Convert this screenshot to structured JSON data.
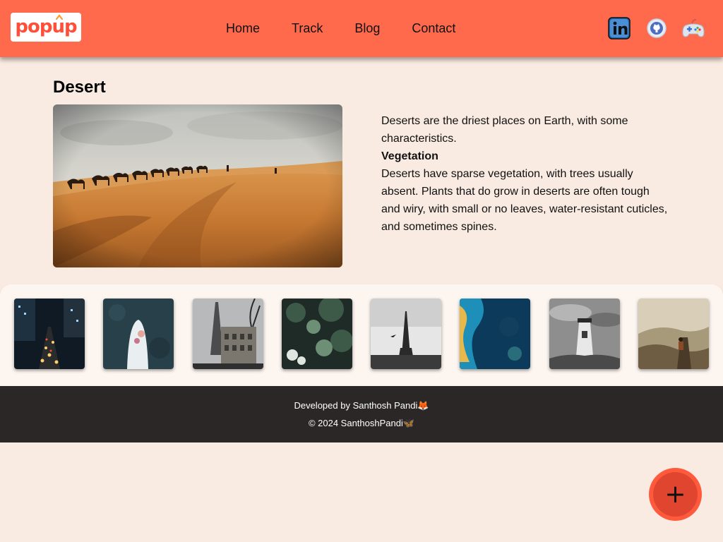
{
  "brand": {
    "logo_text": "popup",
    "accent": "#ff6a4d",
    "logo_color": "#ff4f3a"
  },
  "nav": {
    "items": [
      {
        "label": "Home"
      },
      {
        "label": "Track"
      },
      {
        "label": "Blog"
      },
      {
        "label": "Contact"
      }
    ]
  },
  "social": [
    {
      "icon": "linkedin-icon"
    },
    {
      "icon": "github-icon"
    },
    {
      "icon": "game-controller-icon"
    }
  ],
  "main": {
    "title": "Desert",
    "hero_image": "desert-camel-caravan",
    "intro": "Deserts are the driest places on Earth, with some characteristics.",
    "vegetation_heading": "Vegetation",
    "vegetation_text": "Deserts have sparse vegetation, with trees usually absent. Plants that do grow in deserts are often tough and wiry, with small or no leaves, water-resistant cuticles, and sometimes spines."
  },
  "gallery": [
    {
      "image": "city-night-traffic"
    },
    {
      "image": "woman-white-dress-aerial"
    },
    {
      "image": "paris-eiffel-street"
    },
    {
      "image": "forest-leaves"
    },
    {
      "image": "eiffel-tower-bw"
    },
    {
      "image": "ocean-coast-aerial"
    },
    {
      "image": "lighthouse-bw"
    },
    {
      "image": "hiker-mountains"
    }
  ],
  "footer": {
    "developed_by": "Developed by Santhosh Pandi🦊",
    "copyright": "© 2024 SanthoshPandi🦋"
  },
  "fab": {
    "symbol": "+"
  }
}
